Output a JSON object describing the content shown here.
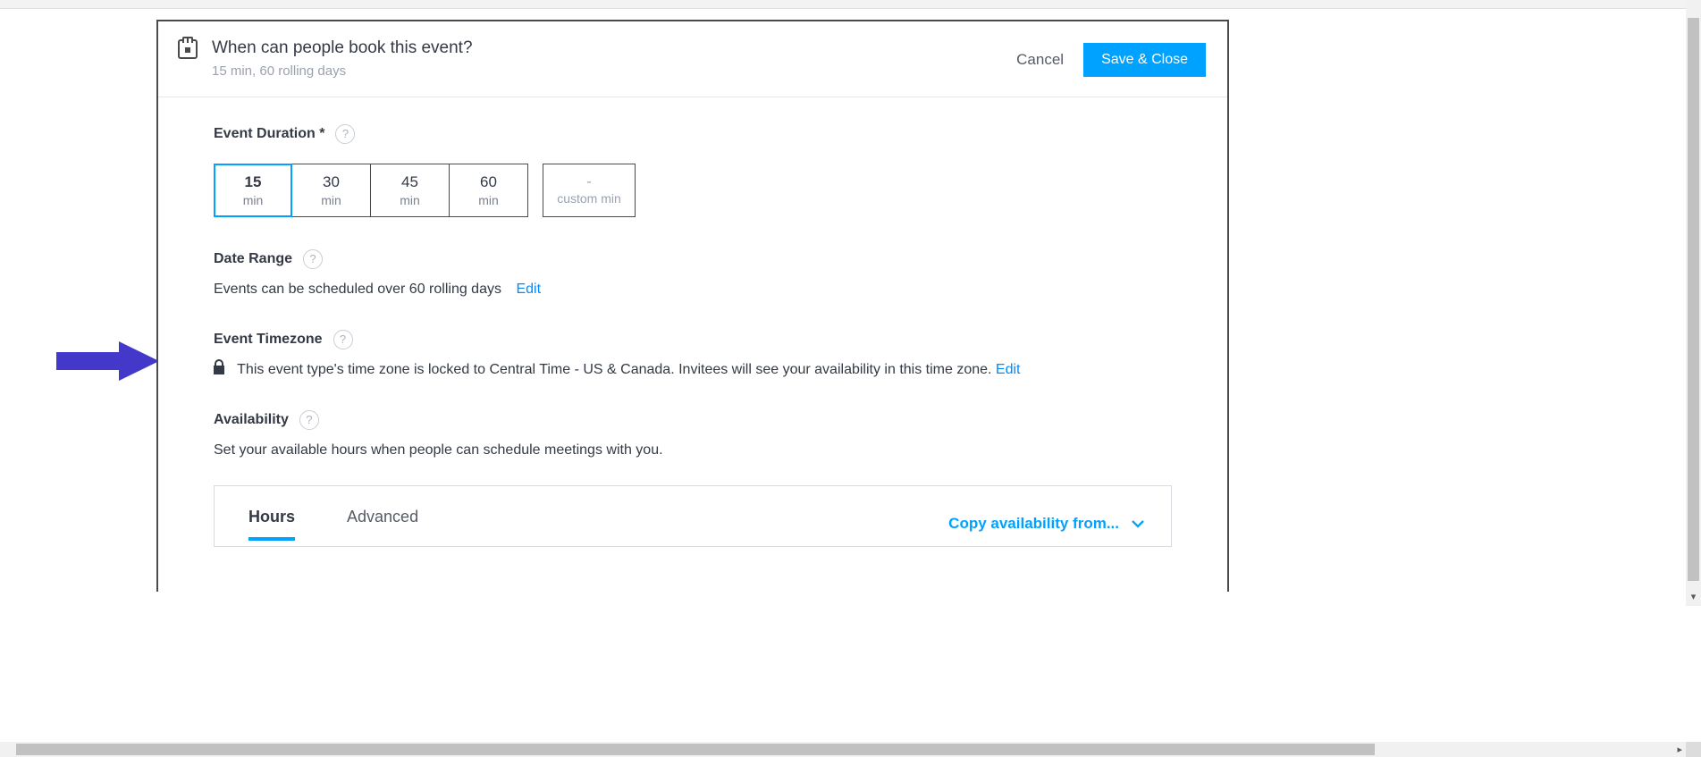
{
  "header": {
    "title": "When can people book this event?",
    "subtitle": "15 min, 60 rolling days",
    "cancel": "Cancel",
    "save": "Save & Close"
  },
  "duration": {
    "label": "Event Duration *",
    "options": [
      {
        "value": "15",
        "unit": "min",
        "selected": true
      },
      {
        "value": "30",
        "unit": "min",
        "selected": false
      },
      {
        "value": "45",
        "unit": "min",
        "selected": false
      },
      {
        "value": "60",
        "unit": "min",
        "selected": false
      }
    ],
    "custom_dash": "-",
    "custom_label": "custom min"
  },
  "date_range": {
    "label": "Date Range",
    "text": "Events can be scheduled over 60 rolling days",
    "edit": "Edit"
  },
  "timezone": {
    "label": "Event Timezone",
    "text": "This event type's time zone is locked to Central Time - US & Canada. Invitees will see your availability in this time zone.",
    "edit": "Edit"
  },
  "availability": {
    "label": "Availability",
    "text": "Set your available hours when people can schedule meetings with you.",
    "tabs": {
      "hours": "Hours",
      "advanced": "Advanced"
    },
    "copy_from": "Copy availability from..."
  }
}
